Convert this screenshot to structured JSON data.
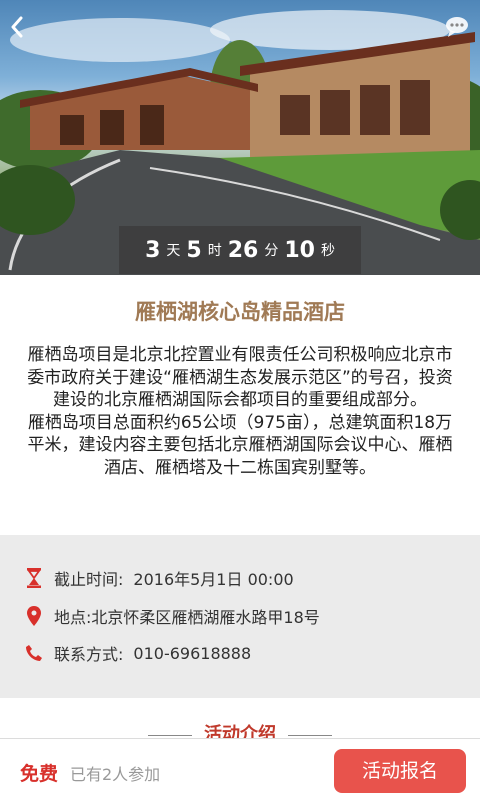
{
  "nav": {
    "back_icon": "chevron-left-icon",
    "chat_icon": "chat-bubble-icon"
  },
  "countdown": {
    "days": "3",
    "days_unit": "天",
    "hours": "5",
    "hours_unit": "时",
    "minutes": "26",
    "minutes_unit": "分",
    "seconds": "10",
    "seconds_unit": "秒"
  },
  "event": {
    "title": "雁栖湖核心岛精品酒店",
    "description": [
      "雁栖岛项目是北京北控置业有限责任公司积极响应北京市委市政府关于建设“雁栖湖生态发展示范区”的号召，投资建设的北京雁栖湖国际会都项目的重要组成部分。",
      "雁栖岛项目总面积约65公顷（975亩），总建筑面积18万平米，建设内容主要包括北京雁栖湖国际会议中心、雁栖酒店、雁栖塔及十二栋国宾别墅等。"
    ]
  },
  "info": {
    "deadline_label": "截止时间:",
    "deadline_value": "2016年5月1日 00:00",
    "location_label": "地点:",
    "location_value": "北京怀柔区雁栖湖雁水路甲18号",
    "contact_label": "联系方式:",
    "contact_value": "010-69618888"
  },
  "section": {
    "heading": "活动介绍"
  },
  "bottom_bar": {
    "price": "免费",
    "joined_text": "已有2人参加",
    "signup_label": "活动报名"
  },
  "colors": {
    "accent": "#e8534c",
    "title": "#a07a55",
    "price": "#d8302b",
    "info_bg": "#ebebeb"
  }
}
